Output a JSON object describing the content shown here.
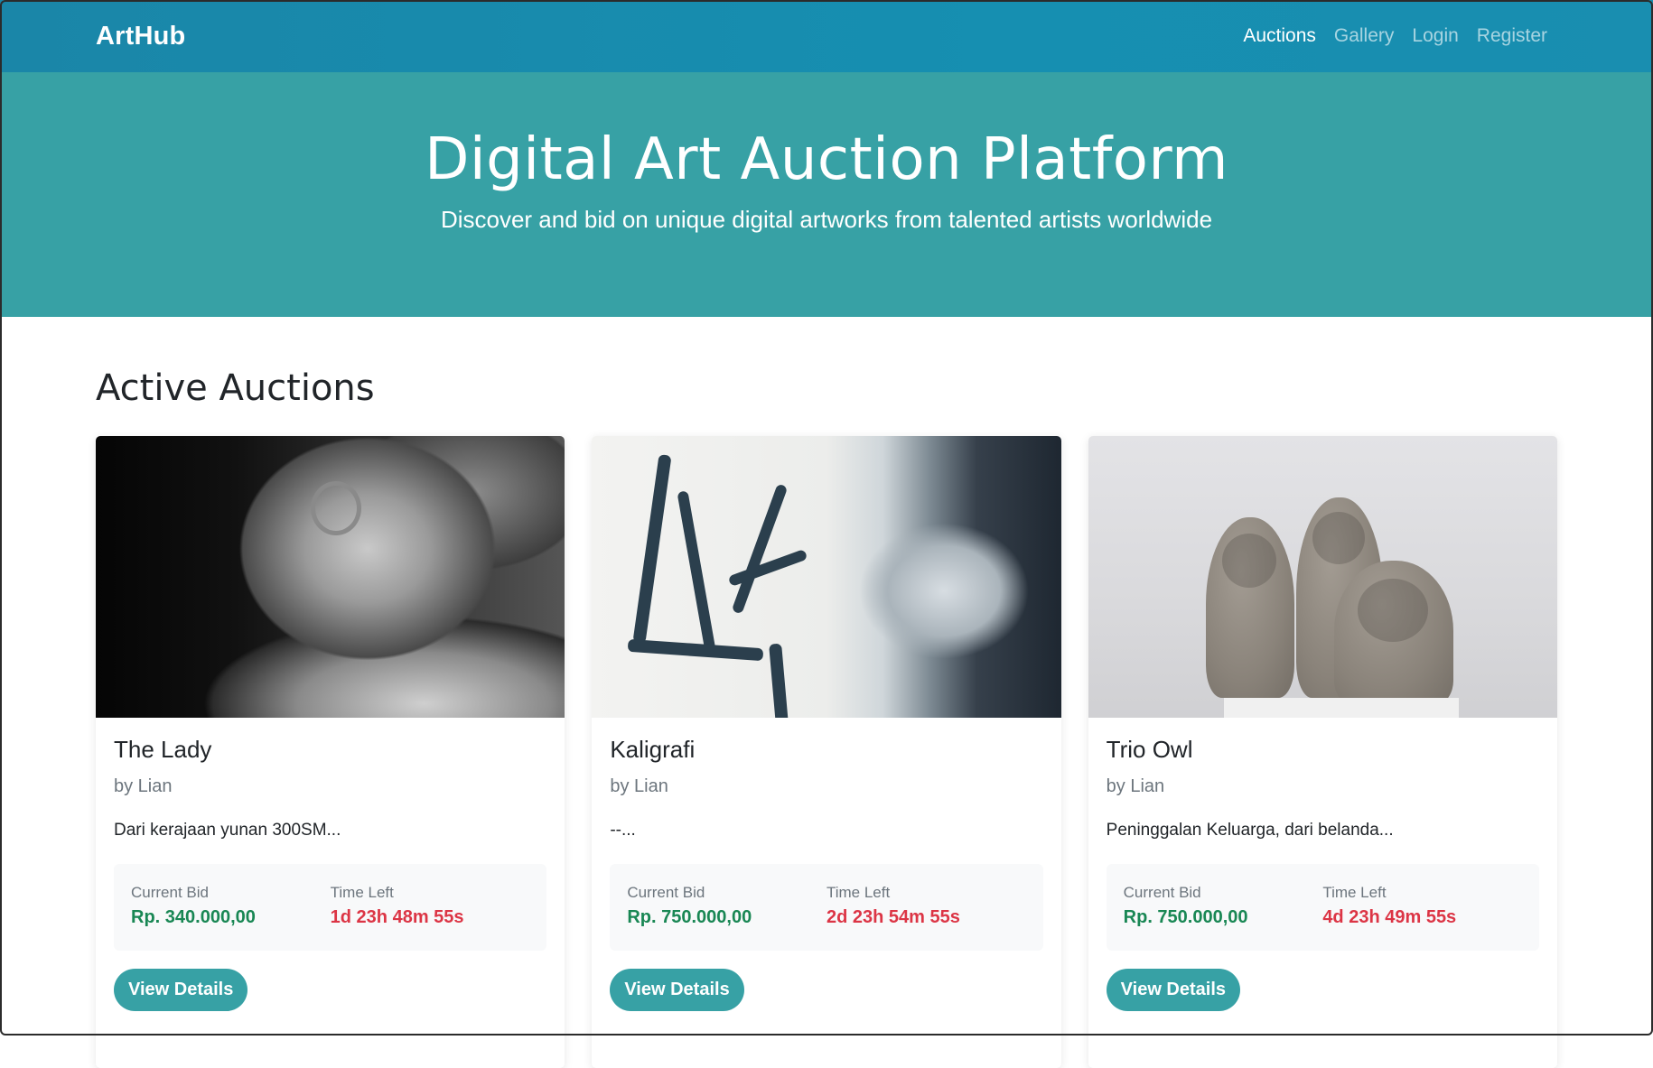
{
  "navbar": {
    "brand": "ArtHub",
    "links": [
      {
        "label": "Auctions",
        "active": true
      },
      {
        "label": "Gallery",
        "active": false
      },
      {
        "label": "Login",
        "active": false
      },
      {
        "label": "Register",
        "active": false
      }
    ]
  },
  "hero": {
    "title": "Digital Art Auction Platform",
    "subtitle": "Discover and bid on unique digital artworks from talented artists worldwide"
  },
  "main": {
    "section_title": "Active Auctions",
    "cards": [
      {
        "title": "The Lady",
        "artist": "by Lian",
        "description": "Dari kerajaan yunan 300SM...",
        "current_bid_label": "Current Bid",
        "current_bid": "Rp. 340.000,00",
        "time_left_label": "Time Left",
        "time_left": "1d 23h 48m 55s",
        "button": "View Details"
      },
      {
        "title": "Kaligrafi",
        "artist": "by Lian",
        "description": "--...",
        "current_bid_label": "Current Bid",
        "current_bid": "Rp. 750.000,00",
        "time_left_label": "Time Left",
        "time_left": "2d 23h 54m 55s",
        "button": "View Details"
      },
      {
        "title": "Trio Owl",
        "artist": "by Lian",
        "description": "Peninggalan Keluarga, dari belanda...",
        "current_bid_label": "Current Bid",
        "current_bid": "Rp. 750.000,00",
        "time_left_label": "Time Left",
        "time_left": "4d 23h 49m 55s",
        "button": "View Details"
      }
    ]
  },
  "colors": {
    "navbar": "#168fb1",
    "hero": "#37a1a5",
    "bid_green": "#198754",
    "time_red": "#dc3545",
    "button": "#37a1a5"
  }
}
